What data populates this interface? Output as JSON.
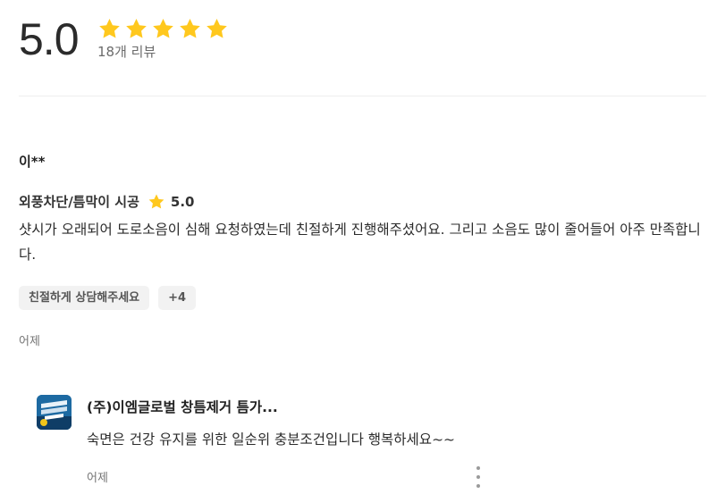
{
  "summary": {
    "score": "5.0",
    "rating": 5,
    "rating_max": 5,
    "review_count": "18개 리뷰",
    "star_color": "#FFC81E"
  },
  "review": {
    "reviewer": "이**",
    "service": "외풍차단/틈막이 시공",
    "score": "5.0",
    "body": "샷시가 오래되어 도로소음이 심해 요청하였는데 친절하게 진행해주셨어요. 그리고 소음도 많이 줄어들어 아주 만족합니다.",
    "tags": [
      "친절하게 상담해주세요",
      "+4"
    ],
    "date": "어제"
  },
  "reply": {
    "company": "(주)이엠글로벌 창틈제거 틈가...",
    "body": "숙면은 건강 유지를 위한 일순위 충분조건입니다 행복하세요~~",
    "date": "어제",
    "more_icon": "vertical-dots-icon"
  }
}
